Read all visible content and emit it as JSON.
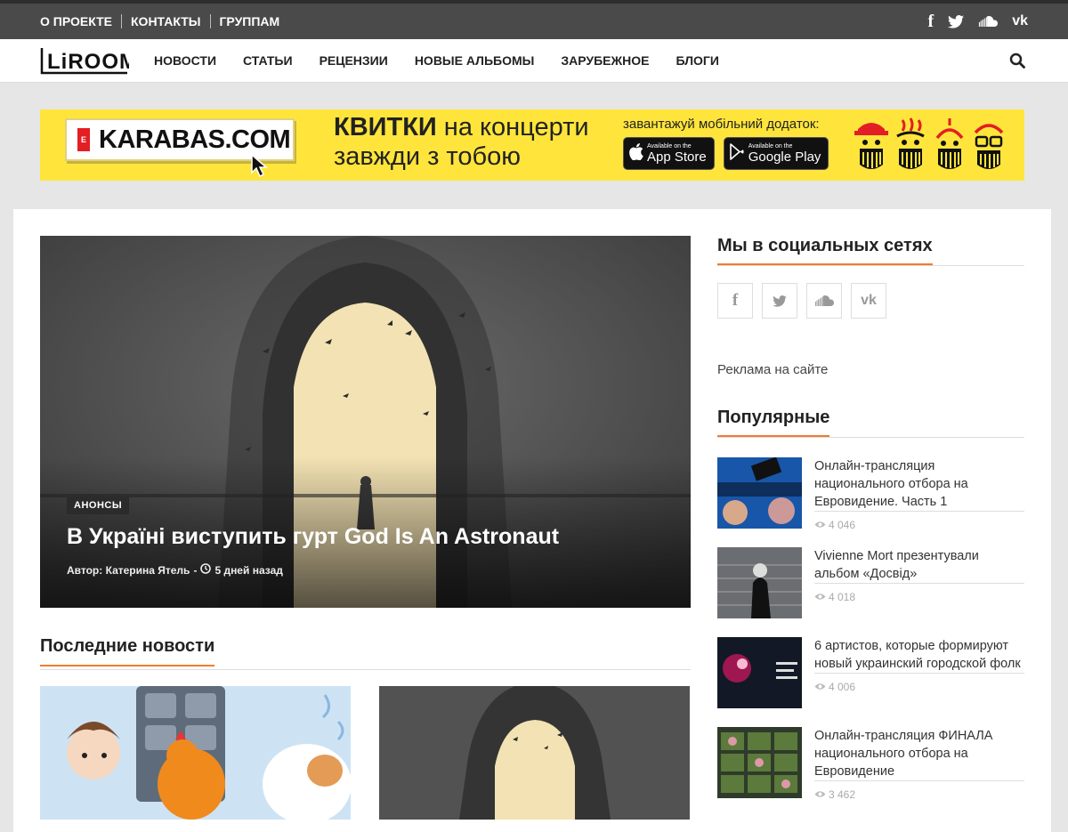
{
  "topbar": {
    "links": [
      "О ПРОЕКТЕ",
      "КОНТАКТЫ",
      "ГРУППАМ"
    ],
    "social_icons": [
      "facebook-icon",
      "twitter-icon",
      "soundcloud-icon",
      "vk-icon"
    ],
    "social_glyphs": {
      "facebook": "f",
      "vk": "vk"
    }
  },
  "nav": {
    "logo": "LiROOM",
    "items": [
      "НОВОСТИ",
      "СТАТЬИ",
      "РЕЦЕНЗИИ",
      "НОВЫЕ АЛЬБОМЫ",
      "ЗАРУБЕЖНОЕ",
      "БЛОГИ"
    ]
  },
  "banner": {
    "brand": "KARABAS.COM",
    "brand_badge": "E",
    "slogan_bold": "КВИТКИ",
    "slogan_rest": " на концерти",
    "slogan_line2": "завжди з тобою",
    "app_label": "завантажуй мобільний додаток:",
    "appstore_small": "Available on the",
    "appstore_big": "App Store",
    "googleplay_small": "Available on the",
    "googleplay_big": "Google Play",
    "color": "#ffe53b"
  },
  "hero": {
    "tag": "АНОНСЫ",
    "title": "В Україні виступить гурт God Is An Astronaut",
    "author": "Автор: Катерина Ятель",
    "separator": "-",
    "time": "5 дней назад"
  },
  "latest": {
    "heading": "Последние новости"
  },
  "sidebar": {
    "social_heading": "Мы в социальных сетях",
    "social_glyphs": [
      "f",
      "t",
      "sc",
      "vk"
    ],
    "ad_link": "Реклама на сайте",
    "popular_heading": "Популярные",
    "popular": [
      {
        "title": "Онлайн-трансляция национального отбора на Евровидение. Часть 1",
        "views": "4 046"
      },
      {
        "title": "Vivienne Mort презентували альбом «Досвід»",
        "views": "4 018"
      },
      {
        "title": "6 артистов, которые формируют новый украинский городской фолк",
        "views": "4 006"
      },
      {
        "title": "Онлайн-трансляция ФИНАЛА национального отбора на Евровидение",
        "views": "3 462"
      }
    ]
  },
  "colors": {
    "accent": "#f07c2d",
    "topbar": "#4a4a4a"
  }
}
